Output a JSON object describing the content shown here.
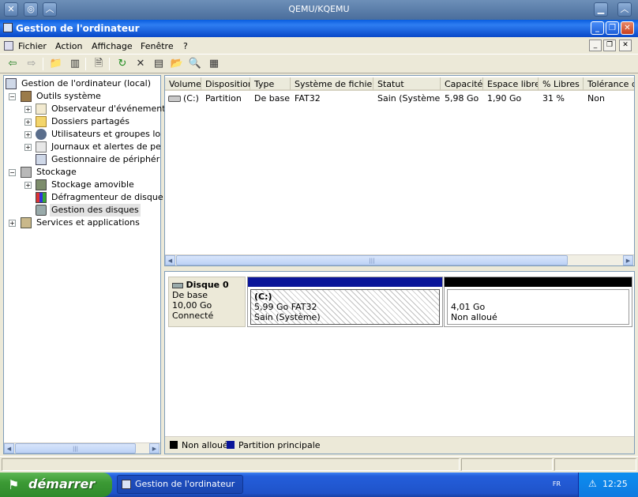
{
  "host": {
    "title": "QEMU/KQEMU"
  },
  "window": {
    "title": "Gestion de l'ordinateur"
  },
  "menu": [
    "Fichier",
    "Action",
    "Affichage",
    "Fenêtre",
    "?"
  ],
  "toolbar": {
    "icons": [
      "back-arrow-icon",
      "forward-arrow-icon",
      "up-folder-icon",
      "show-hide-tree-icon",
      "properties-icon",
      "refresh-icon",
      "delete-icon",
      "properties-sheet-icon",
      "open-folder-icon",
      "find-icon",
      "export-icon"
    ]
  },
  "tree": {
    "root": "Gestion de l'ordinateur (local)",
    "outils": "Outils système",
    "observateur": "Observateur d'événements",
    "dossiers": "Dossiers partagés",
    "utilisateurs": "Utilisateurs et groupes locaux",
    "journaux": "Journaux et alertes de performance",
    "gestionnaire": "Gestionnaire de périphériques",
    "stockage": "Stockage",
    "amovible": "Stockage amovible",
    "defrag": "Défragmenteur de disque",
    "disques": "Gestion des disques",
    "services": "Services et applications"
  },
  "volumes": {
    "columns": [
      "Volume",
      "Disposition",
      "Type",
      "Système de fichiers",
      "Statut",
      "Capacité",
      "Espace libre",
      "% Libres",
      "Tolérance de pannes"
    ],
    "rows": [
      [
        "(C:)",
        "Partition",
        "De base",
        "FAT32",
        "Sain (Système)",
        "5,98 Go",
        "1,90 Go",
        "31 %",
        "Non"
      ]
    ]
  },
  "disk": {
    "name": "Disque 0",
    "type": "De base",
    "size": "10,00 Go",
    "status": "Connecté",
    "partition": {
      "label": "(C:)",
      "size_fs": "5,99 Go FAT32",
      "status": "Sain (Système)"
    },
    "free": {
      "size": "4,01 Go",
      "status": "Non alloué"
    }
  },
  "legend": {
    "unallocated": "Non alloué",
    "primary": "Partition principale",
    "colors": {
      "unallocated": "#000000",
      "primary": "#0a1599"
    }
  },
  "taskbar": {
    "start": "démarrer",
    "task": "Gestion de l'ordinateur",
    "lang": "FR",
    "clock": "12:25"
  }
}
